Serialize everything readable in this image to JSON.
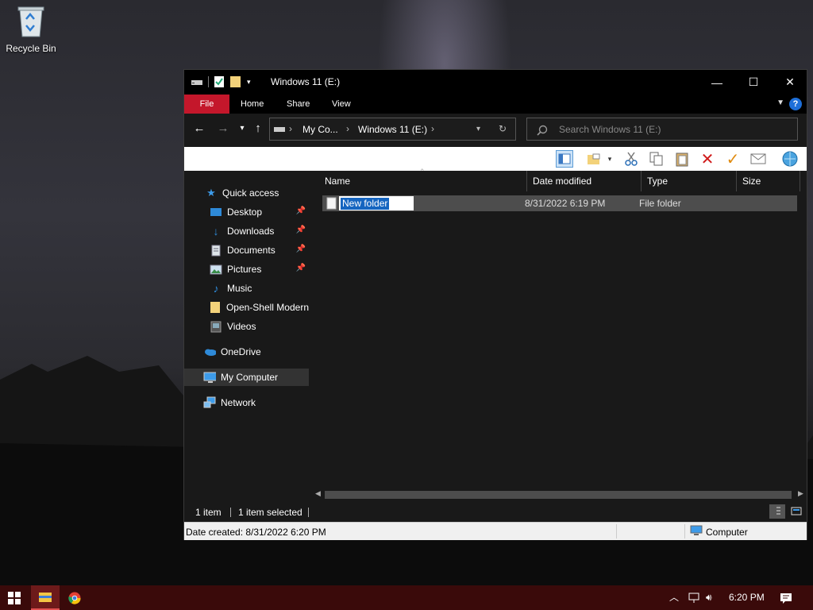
{
  "desktop": {
    "recycle_bin_label": "Recycle Bin"
  },
  "window": {
    "title": "Windows 11 (E:)",
    "controls": {
      "minimize": "—",
      "maximize": "☐",
      "close": "✕"
    }
  },
  "ribbon": {
    "tabs": [
      "File",
      "Home",
      "Share",
      "View"
    ],
    "help": "?"
  },
  "nav": {
    "breadcrumbs": [
      "My Co...",
      "Windows 11 (E:)"
    ],
    "search_placeholder": "Search Windows 11 (E:)"
  },
  "navpane": {
    "quick_access": "Quick access",
    "items": [
      {
        "label": "Desktop",
        "icon": "desktop-icon",
        "pinned": true
      },
      {
        "label": "Downloads",
        "icon": "downloads-icon",
        "pinned": true
      },
      {
        "label": "Documents",
        "icon": "documents-icon",
        "pinned": true
      },
      {
        "label": "Pictures",
        "icon": "pictures-icon",
        "pinned": true
      },
      {
        "label": "Music",
        "icon": "music-icon",
        "pinned": false
      },
      {
        "label": "Open-Shell Modern",
        "icon": "folder-icon",
        "pinned": false
      },
      {
        "label": "Videos",
        "icon": "videos-icon",
        "pinned": false
      }
    ],
    "onedrive": "OneDrive",
    "my_computer": "My Computer",
    "network": "Network"
  },
  "columns": [
    "Name",
    "Date modified",
    "Type",
    "Size"
  ],
  "rows": [
    {
      "name": "New folder",
      "date_modified": "8/31/2022 6:19 PM",
      "type": "File folder",
      "size": ""
    }
  ],
  "status": {
    "item_count": "1 item",
    "selected": "1 item selected"
  },
  "details": {
    "date_created": "Date created: 8/31/2022 6:20 PM",
    "location": "Computer"
  },
  "taskbar": {
    "time": "6:20 PM"
  },
  "colors": {
    "file_tab": "#c4172b",
    "selection": "#1565c0",
    "taskbar": "#3a0a0a"
  }
}
